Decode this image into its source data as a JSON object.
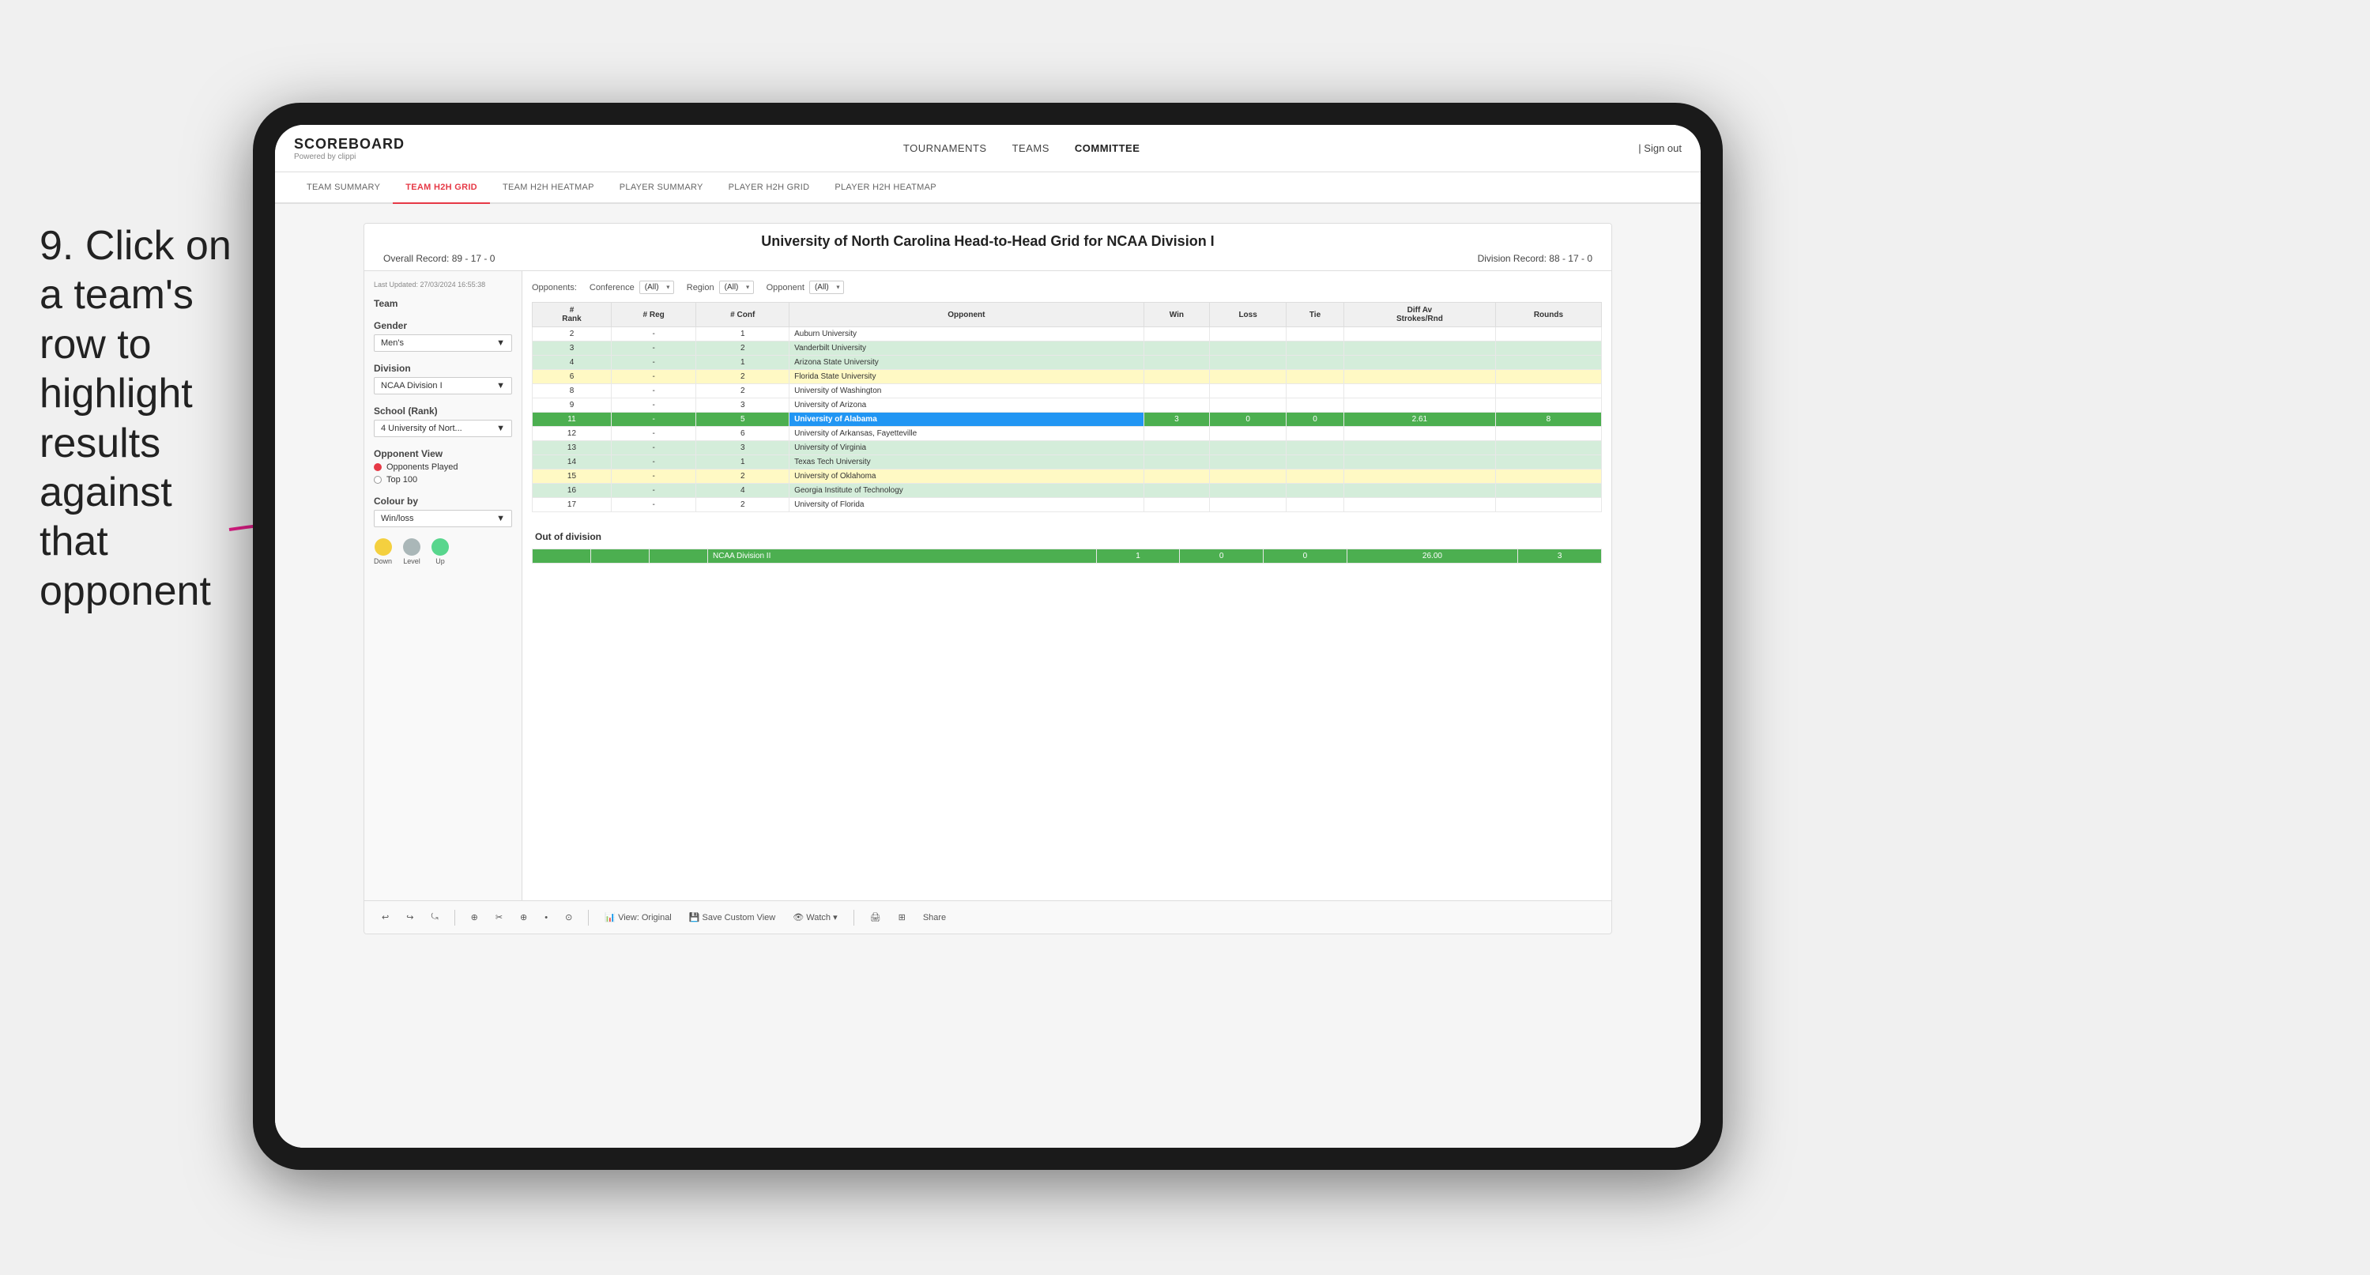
{
  "instruction": {
    "step_number": "9.",
    "text": "Click on a team's row to highlight results against that opponent"
  },
  "nav": {
    "logo": "SCOREBOARD",
    "logo_sub": "Powered by clippi",
    "links": [
      "TOURNAMENTS",
      "TEAMS",
      "COMMITTEE"
    ],
    "sign_out_label": "Sign out"
  },
  "sub_nav": {
    "items": [
      "TEAM SUMMARY",
      "TEAM H2H GRID",
      "TEAM H2H HEATMAP",
      "PLAYER SUMMARY",
      "PLAYER H2H GRID",
      "PLAYER H2H HEATMAP"
    ],
    "active": "TEAM H2H GRID"
  },
  "left_panel": {
    "last_updated": "Last Updated: 27/03/2024 16:55:38",
    "team_label": "Team",
    "gender_label": "Gender",
    "gender_value": "Men's",
    "division_label": "Division",
    "division_value": "NCAA Division I",
    "school_label": "School (Rank)",
    "school_value": "4 University of Nort...",
    "opponent_view_label": "Opponent View",
    "opponent_options": [
      "Opponents Played",
      "Top 100"
    ],
    "opponent_selected": "Opponents Played",
    "colour_by_label": "Colour by",
    "colour_value": "Win/loss",
    "legend": [
      {
        "label": "Down",
        "color": "#f4d03f"
      },
      {
        "label": "Level",
        "color": "#aab7b8"
      },
      {
        "label": "Up",
        "color": "#58d68d"
      }
    ]
  },
  "main": {
    "title": "University of North Carolina Head-to-Head Grid for NCAA Division I",
    "overall_record_label": "Overall Record:",
    "overall_record": "89 - 17 - 0",
    "division_record_label": "Division Record:",
    "division_record": "88 - 17 - 0",
    "filters": {
      "opponents_label": "Opponents:",
      "conference_label": "Conference",
      "conference_value": "(All)",
      "region_label": "Region",
      "region_value": "(All)",
      "opponent_label": "Opponent",
      "opponent_value": "(All)"
    },
    "table_headers": [
      "#\nRank",
      "# Reg",
      "# Conf",
      "Opponent",
      "Win",
      "Loss",
      "Tie",
      "Diff Av\nStrokes/Rnd",
      "Rounds"
    ],
    "rows": [
      {
        "rank": "2",
        "reg": "-",
        "conf": "1",
        "opponent": "Auburn University",
        "win": "",
        "loss": "",
        "tie": "",
        "diff": "",
        "rounds": "",
        "style": "normal"
      },
      {
        "rank": "3",
        "reg": "-",
        "conf": "2",
        "opponent": "Vanderbilt University",
        "win": "",
        "loss": "",
        "tie": "",
        "diff": "",
        "rounds": "",
        "style": "light-green"
      },
      {
        "rank": "4",
        "reg": "-",
        "conf": "1",
        "opponent": "Arizona State University",
        "win": "",
        "loss": "",
        "tie": "",
        "diff": "",
        "rounds": "",
        "style": "light-green"
      },
      {
        "rank": "6",
        "reg": "-",
        "conf": "2",
        "opponent": "Florida State University",
        "win": "",
        "loss": "",
        "tie": "",
        "diff": "",
        "rounds": "",
        "style": "light-yellow"
      },
      {
        "rank": "8",
        "reg": "-",
        "conf": "2",
        "opponent": "University of Washington",
        "win": "",
        "loss": "",
        "tie": "",
        "diff": "",
        "rounds": "",
        "style": "normal"
      },
      {
        "rank": "9",
        "reg": "-",
        "conf": "3",
        "opponent": "University of Arizona",
        "win": "",
        "loss": "",
        "tie": "",
        "diff": "",
        "rounds": "",
        "style": "normal"
      },
      {
        "rank": "11",
        "reg": "-",
        "conf": "5",
        "opponent": "University of Alabama",
        "win": "3",
        "loss": "0",
        "tie": "0",
        "diff": "2.61",
        "rounds": "8",
        "style": "highlighted"
      },
      {
        "rank": "12",
        "reg": "-",
        "conf": "6",
        "opponent": "University of Arkansas, Fayetteville",
        "win": "",
        "loss": "",
        "tie": "",
        "diff": "",
        "rounds": "",
        "style": "normal"
      },
      {
        "rank": "13",
        "reg": "-",
        "conf": "3",
        "opponent": "University of Virginia",
        "win": "",
        "loss": "",
        "tie": "",
        "diff": "",
        "rounds": "",
        "style": "light-green"
      },
      {
        "rank": "14",
        "reg": "-",
        "conf": "1",
        "opponent": "Texas Tech University",
        "win": "",
        "loss": "",
        "tie": "",
        "diff": "",
        "rounds": "",
        "style": "light-green"
      },
      {
        "rank": "15",
        "reg": "-",
        "conf": "2",
        "opponent": "University of Oklahoma",
        "win": "",
        "loss": "",
        "tie": "",
        "diff": "",
        "rounds": "",
        "style": "light-yellow"
      },
      {
        "rank": "16",
        "reg": "-",
        "conf": "4",
        "opponent": "Georgia Institute of Technology",
        "win": "",
        "loss": "",
        "tie": "",
        "diff": "",
        "rounds": "",
        "style": "light-green"
      },
      {
        "rank": "17",
        "reg": "-",
        "conf": "2",
        "opponent": "University of Florida",
        "win": "",
        "loss": "",
        "tie": "",
        "diff": "",
        "rounds": "",
        "style": "normal"
      }
    ],
    "out_of_division_label": "Out of division",
    "out_of_division_row": {
      "label": "NCAA Division II",
      "win": "1",
      "loss": "0",
      "tie": "0",
      "diff": "26.00",
      "rounds": "3"
    }
  },
  "toolbar": {
    "buttons": [
      "↩",
      "↪",
      "⤿",
      "⊕",
      "✂",
      "⊕",
      "•",
      "⊙",
      "View: Original",
      "Save Custom View",
      "Watch ▾",
      "🖨",
      "⊞",
      "Share"
    ]
  }
}
